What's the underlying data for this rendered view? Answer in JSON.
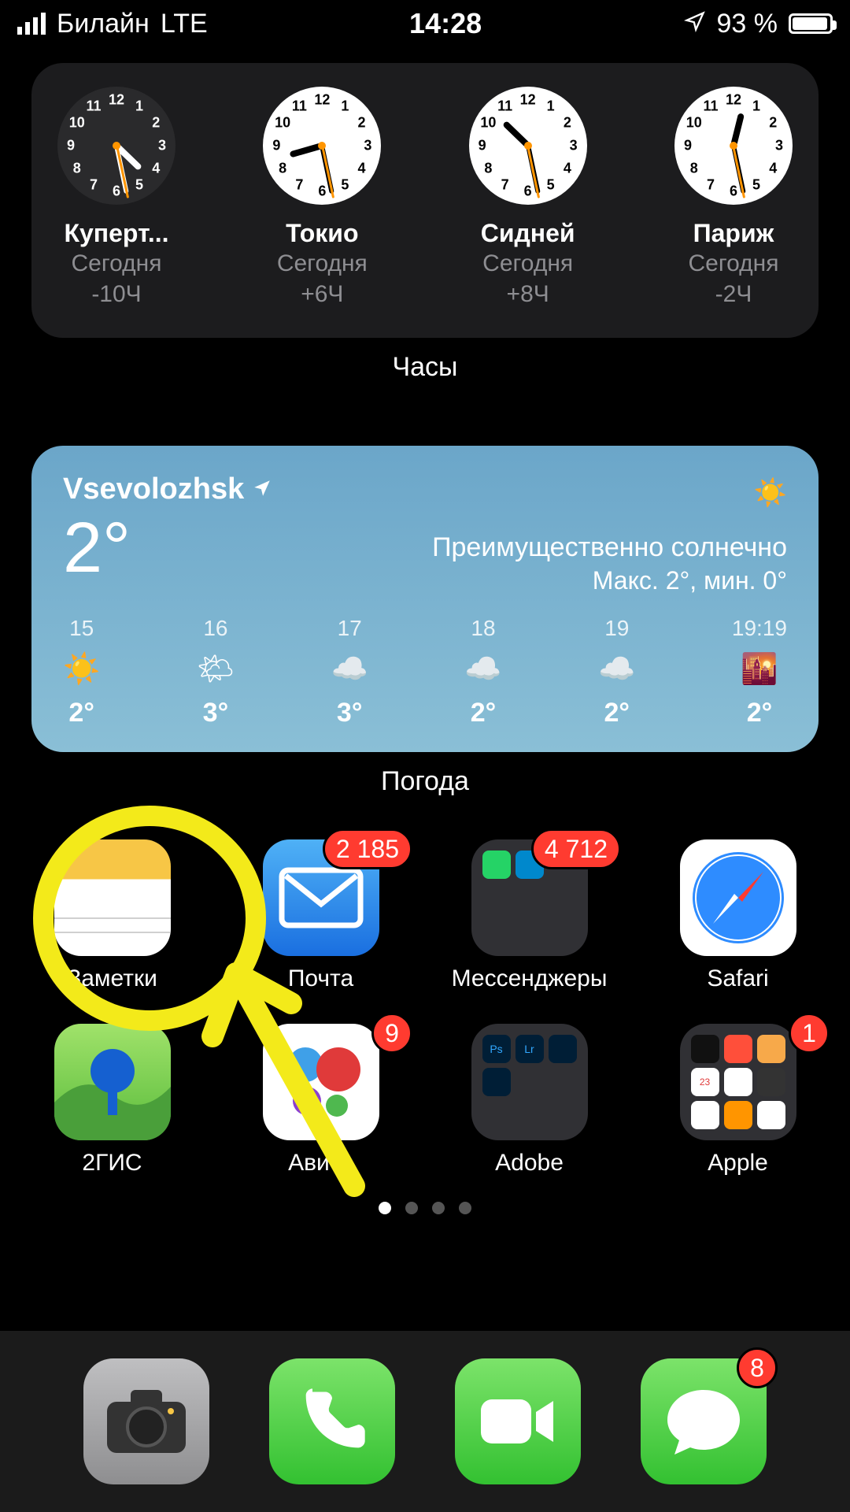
{
  "status": {
    "carrier": "Билайн",
    "network": "LTE",
    "time": "14:28",
    "location_icon": "location-arrow",
    "battery_pct": "93 %"
  },
  "clock_widget": {
    "label": "Часы",
    "items": [
      {
        "city": "Куперт...",
        "day": "Сегодня",
        "offset": "-10Ч",
        "face": "dark",
        "h": 4,
        "m": 28
      },
      {
        "city": "Токио",
        "day": "Сегодня",
        "offset": "+6Ч",
        "face": "light",
        "h": 20,
        "m": 28
      },
      {
        "city": "Сидней",
        "day": "Сегодня",
        "offset": "+8Ч",
        "face": "light",
        "h": 22,
        "m": 28
      },
      {
        "city": "Париж",
        "day": "Сегодня",
        "offset": "-2Ч",
        "face": "light",
        "h": 12,
        "m": 28
      }
    ]
  },
  "weather_widget": {
    "label": "Погода",
    "location": "Vsevolozhsk",
    "temp": "2°",
    "condition": "Преимущественно солнечно",
    "range": "Макс. 2°, мин. 0°",
    "hourly": [
      {
        "t": "15",
        "icon": "☀️",
        "d": "2°"
      },
      {
        "t": "16",
        "icon": "🌤",
        "d": "3°"
      },
      {
        "t": "17",
        "icon": "☁️",
        "d": "3°"
      },
      {
        "t": "18",
        "icon": "☁️",
        "d": "2°"
      },
      {
        "t": "19",
        "icon": "☁️",
        "d": "2°"
      },
      {
        "t": "19:19",
        "icon": "🌇",
        "d": "2°"
      }
    ]
  },
  "apps_row1": [
    {
      "name": "Заметки",
      "icon": "notes",
      "badge": null
    },
    {
      "name": "Почта",
      "icon": "mail",
      "badge": "2 185"
    },
    {
      "name": "Мессенджеры",
      "icon": "folder-messengers",
      "badge": "4 712"
    },
    {
      "name": "Safari",
      "icon": "safari",
      "badge": null
    }
  ],
  "apps_row2": [
    {
      "name": "2ГИС",
      "icon": "2gis",
      "badge": null
    },
    {
      "name": "Авито",
      "icon": "avito",
      "badge": "9"
    },
    {
      "name": "Adobe",
      "icon": "folder-adobe",
      "badge": null
    },
    {
      "name": "Apple",
      "icon": "folder-apple",
      "badge": "1"
    }
  ],
  "page_dots": {
    "count": 4,
    "active": 0
  },
  "dock": [
    {
      "name": "Камера",
      "icon": "camera",
      "badge": null
    },
    {
      "name": "Телефон",
      "icon": "phone",
      "badge": null
    },
    {
      "name": "FaceTime",
      "icon": "facetime",
      "badge": null
    },
    {
      "name": "Сообщения",
      "icon": "messages",
      "badge": "8"
    }
  ],
  "annotation": {
    "circle_target": "Заметки",
    "arrow": true,
    "color": "#f3ea1a"
  }
}
